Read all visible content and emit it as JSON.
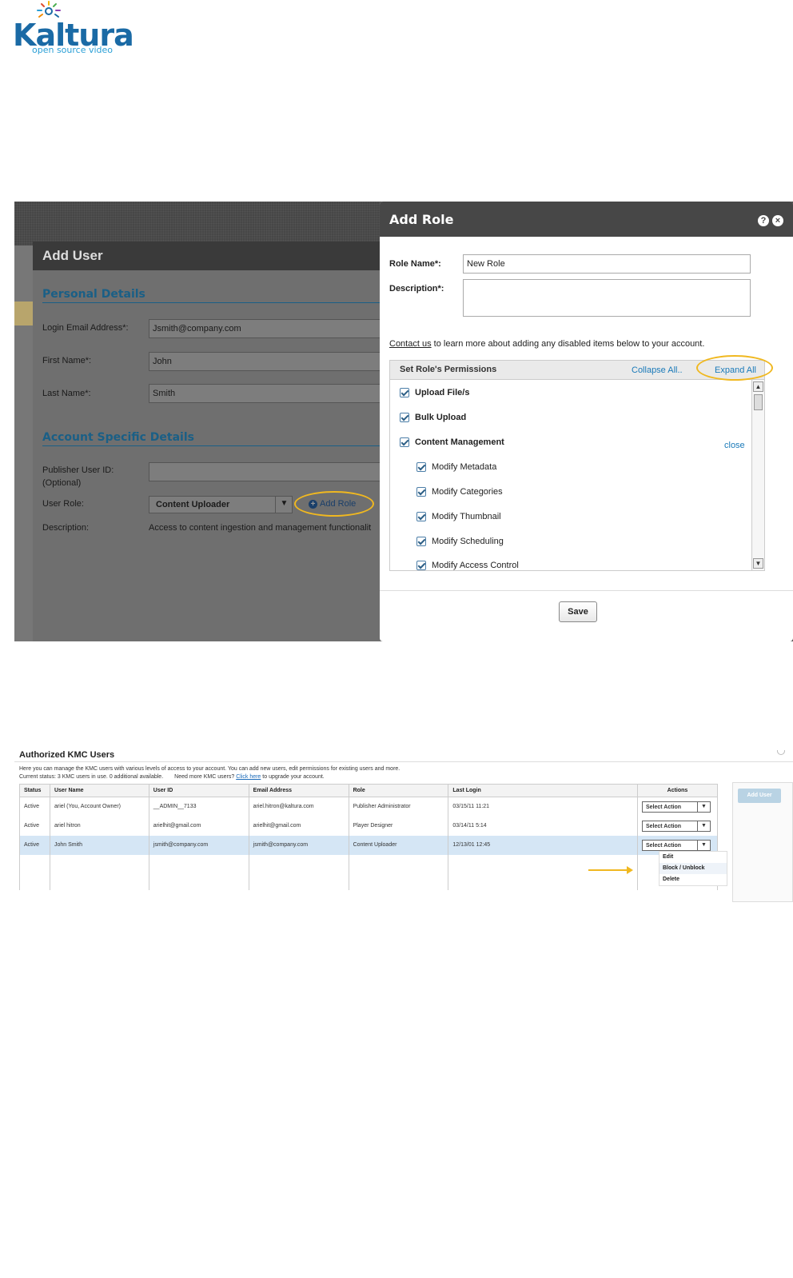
{
  "logo": {
    "name": "Kaltura",
    "tagline": "open source video",
    "color": "#1a6aa5"
  },
  "add_user": {
    "title": "Add User",
    "personal_title": "Personal Details",
    "account_title": "Account Specific Details",
    "fields": {
      "login_label": "Login Email Address*:",
      "login_value": "Jsmith@company.com",
      "first_label": "First Name*:",
      "first_value": "John",
      "last_label": "Last Name*:",
      "last_value": "Smith",
      "publisher_label": "Publisher User ID:",
      "publisher_optional": "(Optional)",
      "role_label": "User Role:",
      "role_value": "Content Uploader",
      "add_role": "Add Role",
      "desc_label": "Description:",
      "desc_value": "Access to content ingestion and management functionalit"
    }
  },
  "add_role": {
    "title": "Add Role",
    "role_name_label": "Role Name*:",
    "role_name_value": "New Role",
    "description_label": "Description*:",
    "contact_link": "Contact us",
    "contact_text": " to learn more about adding any disabled items below to your account.",
    "permissions_title": "Set Role's Permissions",
    "collapse_all": "Collapse All..",
    "expand_all": "Expand All",
    "close": "close",
    "top_items": [
      "Upload File/s",
      "Bulk Upload",
      "Content Management"
    ],
    "sub_items": [
      "Modify Metadata",
      "Modify Categories",
      "Modify Thumbnail",
      "Modify Scheduling",
      "Modify Access Control"
    ],
    "save": "Save"
  },
  "kmc_users": {
    "title": "Authorized KMC Users",
    "intro": "Here you can manage the KMC users with various levels of access to your account. You can add new users, edit permissions for existing users and more.",
    "status_text": "Current status: 3 KMC users in use. 0 additional available.",
    "need_more": "Need more KMC users?",
    "click_here": "Click here",
    "upgrade": "to upgrade your account.",
    "columns": [
      "Status",
      "User Name",
      "User ID",
      "Email Address",
      "Role",
      "Last Login",
      "Actions"
    ],
    "rows": [
      [
        "Active",
        "ariel (You, Account Owner)",
        "__ADMIN__7133",
        "ariel.hitron@kaltura.com",
        "Publisher Administrator",
        "03/15/11 11:21"
      ],
      [
        "Active",
        "ariel hitron",
        "arielhit@gmail.com",
        "arielhit@gmail.com",
        "Player Designer",
        "03/14/11 5:14"
      ],
      [
        "Active",
        "John Smith",
        "jsmith@company.com",
        "jsmith@company.com",
        "Content Uploader",
        "12/13/01 12:45"
      ]
    ],
    "select_action": "Select Action",
    "menu": [
      "Edit",
      "Block / Unblock",
      "Delete"
    ],
    "add_user_btn": "Add User"
  }
}
